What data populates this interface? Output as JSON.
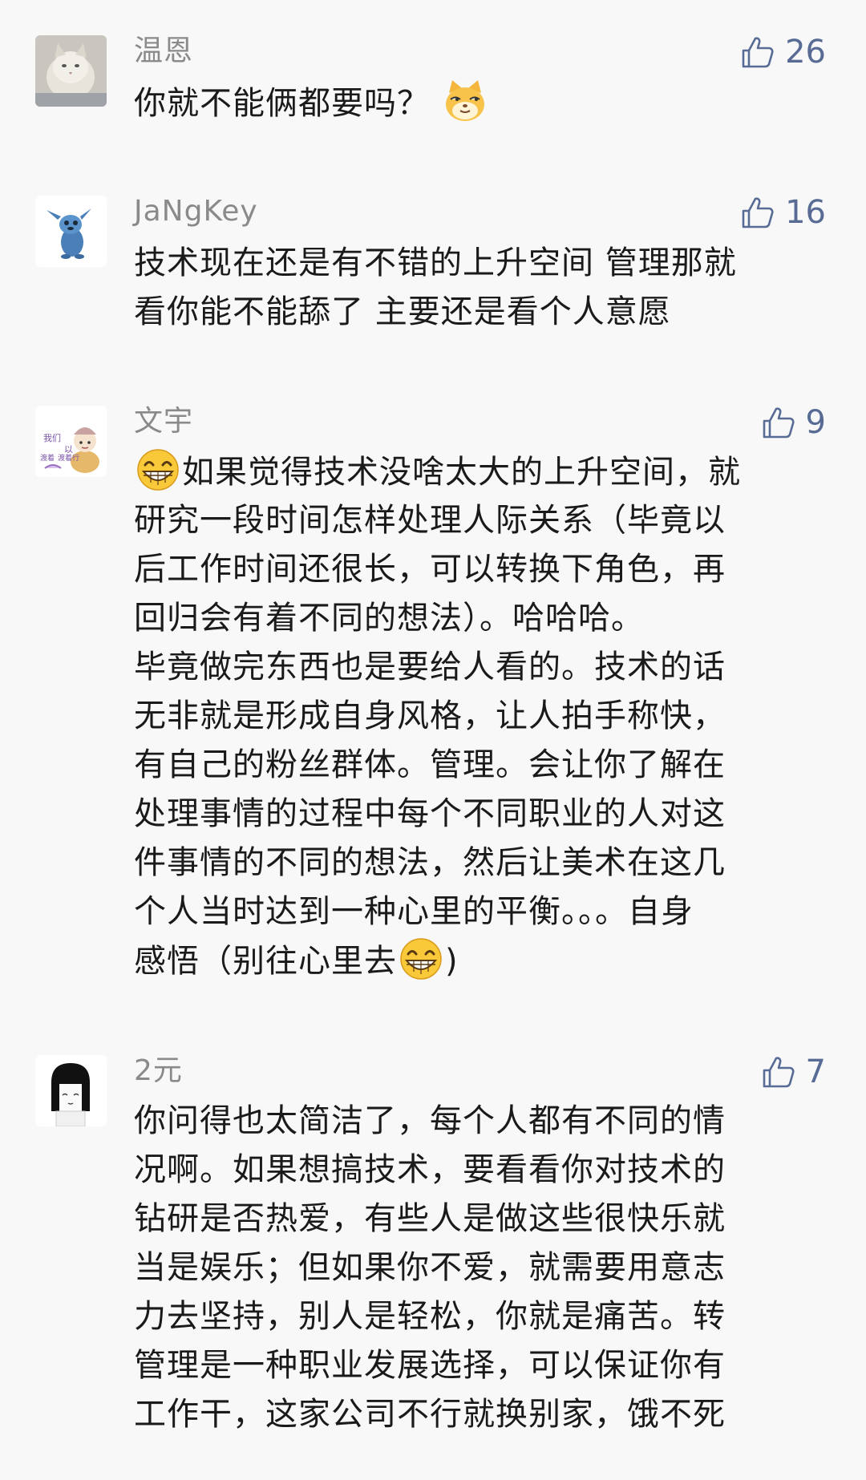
{
  "icons": {
    "like": "thumbs-up-icon",
    "emoji_cat": "doge-cat-emoji",
    "emoji_grin": "grinning-face-emoji"
  },
  "colors": {
    "background": "#f8f8f8",
    "nickname": "#8a8a8a",
    "like": "#576b95",
    "text": "#1a1a1a"
  },
  "comments": [
    {
      "nickname": "温恩",
      "likes": "26",
      "lines": [
        {
          "parts": [
            "你就不能俩都要吗？"
          ]
        }
      ]
    },
    {
      "nickname": "JaNgKey",
      "likes": "16",
      "lines": [
        {
          "parts": [
            "技术现在还是有不错的上升空间 管理那就"
          ]
        },
        {
          "parts": [
            "看你能不能舔了  主要还是看个人意愿"
          ]
        }
      ]
    },
    {
      "nickname": "文宇",
      "likes": "9",
      "avatar_text": [
        "我们",
        "以",
        "渡着",
        "渡着行"
      ],
      "lines": [
        {
          "parts": [
            "如果觉得技术没啥太大的上升空间，就"
          ]
        },
        {
          "parts": [
            "研究一段时间怎样处理人际关系（毕竟以"
          ]
        },
        {
          "parts": [
            "后工作时间还很长，可以转换下角色，再"
          ]
        },
        {
          "parts": [
            "回归会有着不同的想法）。哈哈哈。"
          ]
        },
        {
          "parts": [
            "毕竟做完东西也是要给人看的。技术的话"
          ]
        },
        {
          "parts": [
            "无非就是形成自身风格，让人拍手称快，"
          ]
        },
        {
          "parts": [
            "有自己的粉丝群体。管理。会让你了解在"
          ]
        },
        {
          "parts": [
            "处理事情的过程中每个不同职业的人对这"
          ]
        },
        {
          "parts": [
            "件事情的不同的想法，然后让美术在这几"
          ]
        },
        {
          "parts": [
            "个人当时达到一种心里的平衡。。。自身"
          ]
        },
        {
          "parts": [
            "感悟（别往心里去",
            ")"
          ]
        }
      ]
    },
    {
      "nickname": "2元",
      "likes": "7",
      "lines": [
        {
          "parts": [
            "你问得也太简洁了，每个人都有不同的情"
          ]
        },
        {
          "parts": [
            "况啊。如果想搞技术，要看看你对技术的"
          ]
        },
        {
          "parts": [
            "钻研是否热爱，有些人是做这些很快乐就"
          ]
        },
        {
          "parts": [
            "当是娱乐；但如果你不爱，就需要用意志"
          ]
        },
        {
          "parts": [
            "力去坚持，别人是轻松，你就是痛苦。转"
          ]
        },
        {
          "parts": [
            "管理是一种职业发展选择，可以保证你有"
          ]
        },
        {
          "parts": [
            "工作干，这家公司不行就换别家，饿不死"
          ]
        }
      ]
    }
  ]
}
